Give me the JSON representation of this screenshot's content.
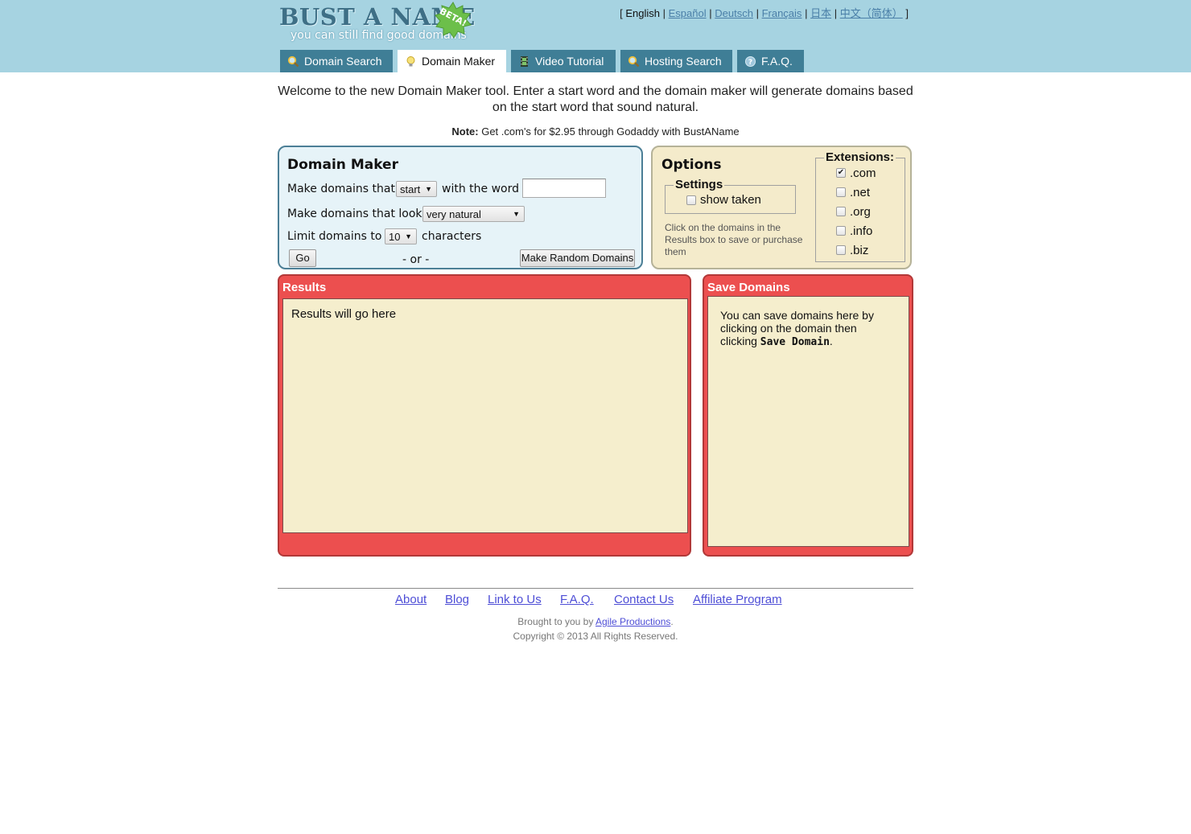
{
  "logo": {
    "title": "BUST A NAME",
    "tagline": "you can still find good domains",
    "badge": "BETA!"
  },
  "languages": {
    "open_bracket": "[",
    "close_bracket": "]",
    "separator": "|",
    "current": "English",
    "items": [
      "Español",
      "Deutsch",
      "Français",
      "日本",
      "中文（简体）"
    ]
  },
  "tabs": [
    {
      "label": "Domain Search",
      "icon": "magnifier-icon"
    },
    {
      "label": "Domain Maker",
      "icon": "lightbulb-icon",
      "active": true
    },
    {
      "label": "Video Tutorial",
      "icon": "film-icon"
    },
    {
      "label": "Hosting Search",
      "icon": "magnifier-icon"
    },
    {
      "label": "F.A.Q.",
      "icon": "question-icon"
    }
  ],
  "intro": "Welcome to the new Domain Maker tool. Enter a start word and the domain maker will generate domains based on the start word that sound natural.",
  "note": {
    "label": "Note:",
    "text": "Get .com's for $2.95 through Godaddy with BustAName"
  },
  "maker": {
    "title": "Domain Maker",
    "row1_prefix": "Make domains that",
    "position_select": "start",
    "row1_suffix": "with the word",
    "word_value": "",
    "row2_prefix": "Make domains that look",
    "look_select": "very natural",
    "row3_prefix": "Limit domains to",
    "limit_select": "10",
    "row3_suffix": "characters",
    "go_button": "Go",
    "or_text": "- or -",
    "random_button": "Make Random Domains"
  },
  "options": {
    "title": "Options",
    "settings_legend": "Settings",
    "show_taken_label": "show taken",
    "show_taken_checked": false,
    "hint": "Click on the domains in the Results box to save or purchase them",
    "extensions_legend": "Extensions:",
    "extensions": [
      {
        "label": ".com",
        "checked": true
      },
      {
        "label": ".net",
        "checked": false
      },
      {
        "label": ".org",
        "checked": false
      },
      {
        "label": ".info",
        "checked": false
      },
      {
        "label": ".biz",
        "checked": false
      }
    ]
  },
  "results": {
    "title": "Results",
    "placeholder": "Results will go here"
  },
  "save": {
    "title": "Save Domains",
    "text_before": "You can save domains here by clicking on the domain then clicking",
    "text_bold": "Save Domain",
    "text_after": "."
  },
  "footer": {
    "links": [
      "About",
      "Blog",
      "Link to Us",
      "F.A.Q.",
      "Contact Us",
      "Affiliate Program"
    ],
    "brought_prefix": "Brought to you by",
    "brought_link": "Agile Productions",
    "brought_suffix": ".",
    "copyright": "Copyright © 2013 All Rights Reserved."
  },
  "colors": {
    "header_bg": "#a6d3e1",
    "tab_bg": "#3f7e96",
    "maker_bg": "#e6f3f8",
    "options_bg": "#f4ebcb",
    "red_panel": "#ec4f4f",
    "link": "#4e4ed6"
  }
}
